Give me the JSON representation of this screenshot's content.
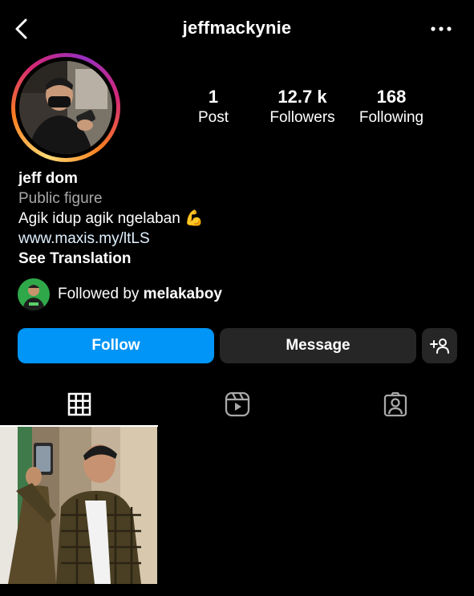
{
  "header": {
    "username": "jeffmackynie",
    "back_icon": "chevron-left-icon",
    "more_icon": "more-horizontal-icon"
  },
  "stats": {
    "posts": {
      "value": "1",
      "label": "Post"
    },
    "followers": {
      "value": "12.7 k",
      "label": "Followers"
    },
    "following": {
      "value": "168",
      "label": "Following"
    }
  },
  "bio": {
    "name": "jeff dom",
    "category": "Public figure",
    "text": "Agik idup agik ngelaban 💪",
    "link": "www.maxis.my/ltLS",
    "translation": "See Translation"
  },
  "followed_by": {
    "prefix": "Followed by ",
    "username": "melakaboy"
  },
  "actions": {
    "follow_label": "Follow",
    "message_label": "Message",
    "add_user_icon": "add-user-icon"
  },
  "tabs": [
    {
      "name": "posts-grid",
      "icon": "grid-icon",
      "active": true
    },
    {
      "name": "reels",
      "icon": "reels-icon",
      "active": false
    },
    {
      "name": "tagged",
      "icon": "tagged-person-icon",
      "active": false
    }
  ],
  "colors": {
    "background": "#000000",
    "primary_button": "#0095f6",
    "secondary_button": "#262626",
    "muted_text": "#a8a8a8"
  }
}
